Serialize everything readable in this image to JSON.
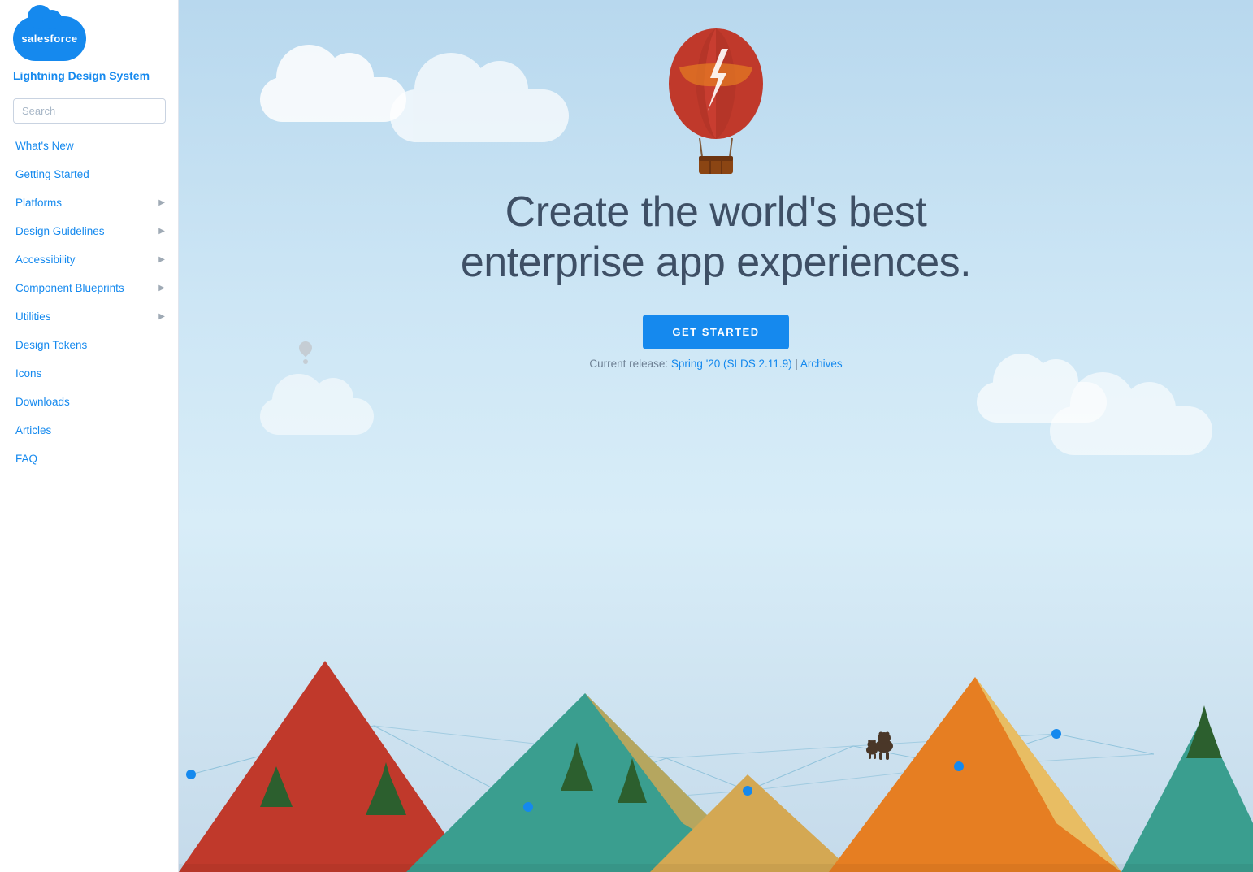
{
  "sidebar": {
    "logo_text": "salesforce",
    "title": "Lightning Design System",
    "search_placeholder": "Search",
    "nav_items": [
      {
        "id": "whats-new",
        "label": "What's New",
        "has_arrow": false
      },
      {
        "id": "getting-started",
        "label": "Getting Started",
        "has_arrow": false
      },
      {
        "id": "platforms",
        "label": "Platforms",
        "has_arrow": true
      },
      {
        "id": "design-guidelines",
        "label": "Design Guidelines",
        "has_arrow": true
      },
      {
        "id": "accessibility",
        "label": "Accessibility",
        "has_arrow": true
      },
      {
        "id": "component-blueprints",
        "label": "Component Blueprints",
        "has_arrow": true
      },
      {
        "id": "utilities",
        "label": "Utilities",
        "has_arrow": true
      },
      {
        "id": "design-tokens",
        "label": "Design Tokens",
        "has_arrow": false
      },
      {
        "id": "icons",
        "label": "Icons",
        "has_arrow": false
      },
      {
        "id": "downloads",
        "label": "Downloads",
        "has_arrow": false
      },
      {
        "id": "articles",
        "label": "Articles",
        "has_arrow": false
      },
      {
        "id": "faq",
        "label": "FAQ",
        "has_arrow": false
      }
    ]
  },
  "hero": {
    "heading_line1": "Create the world's best",
    "heading_line2": "enterprise app experiences.",
    "cta_label": "GET STARTED",
    "release_prefix": "Current release: ",
    "release_link_text": "Spring '20 (SLDS 2.11.9)",
    "release_separator": " | ",
    "archives_link_text": "Archives"
  }
}
